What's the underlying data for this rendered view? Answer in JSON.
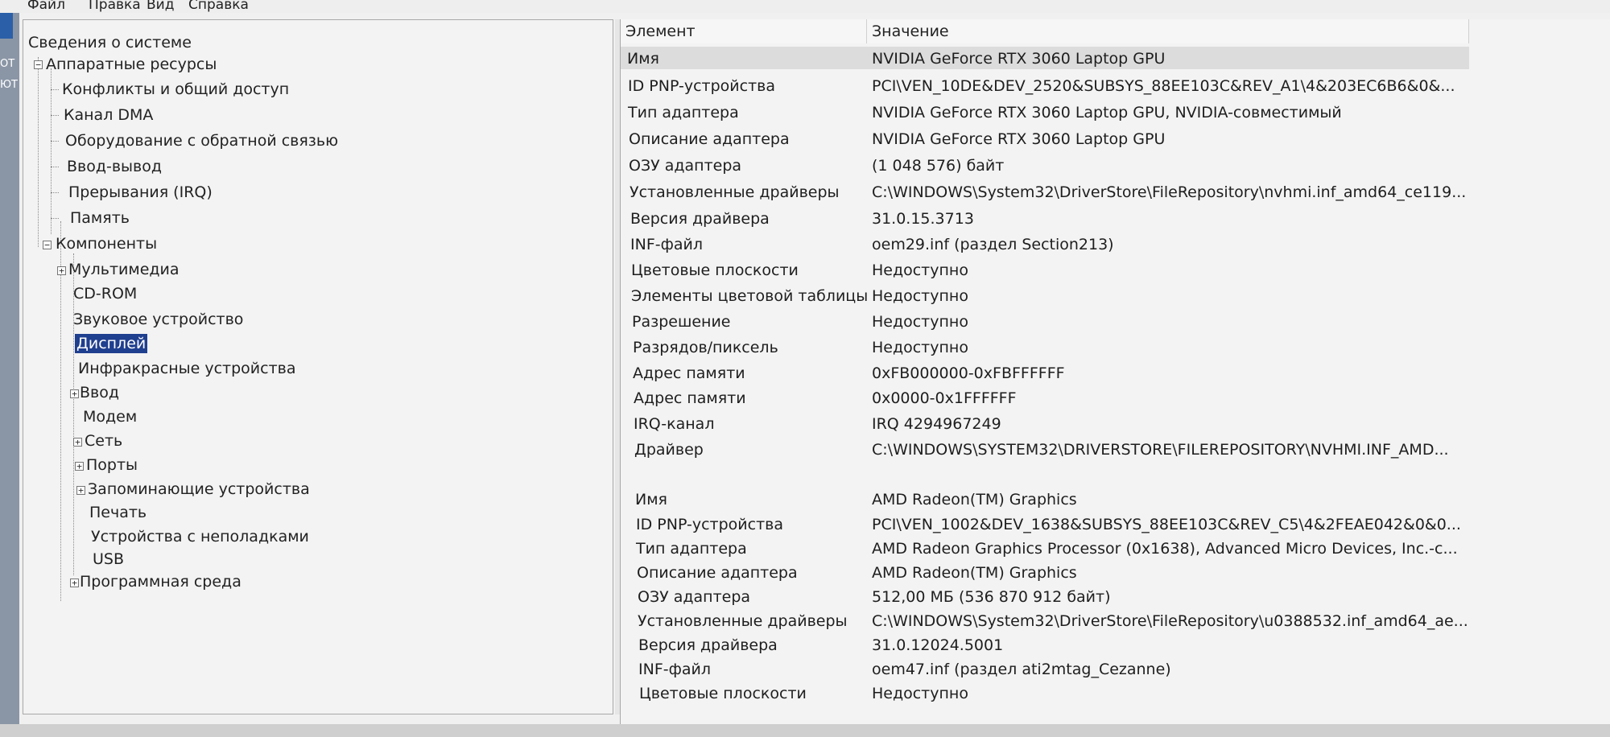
{
  "menu": {
    "file": "Файл",
    "edit": "Правка",
    "view": "Вид",
    "help": "Справка"
  },
  "background_fragments": [
    "ОТ",
    "ЮТ"
  ],
  "tree": {
    "root": "Сведения о системе",
    "hardware": {
      "label": "Аппаратные ресурсы",
      "items": [
        "Конфликты и общий доступ",
        "Канал DMA",
        "Оборудование с обратной связью",
        "Ввод-вывод",
        "Прерывания (IRQ)",
        "Память"
      ]
    },
    "components": {
      "label": "Компоненты",
      "items": [
        "Мультимедиа",
        "CD-ROM",
        "Звуковое устройство",
        "Дисплей",
        "Инфракрасные устройства",
        "Ввод",
        "Модем",
        "Сеть",
        "Порты",
        "Запоминающие устройства",
        "Печать",
        "Устройства с неполадками",
        "USB"
      ]
    },
    "software": "Программная среда",
    "selected": "Дисплей"
  },
  "list": {
    "columns": [
      "Элемент",
      "Значение"
    ],
    "rows": [
      [
        "Имя",
        "NVIDIA GeForce RTX 3060 Laptop GPU"
      ],
      [
        "ID PNP-устройства",
        "PCI\\VEN_10DE&DEV_2520&SUBSYS_88EE103C&REV_A1\\4&203EC6B6&0&..."
      ],
      [
        "Тип адаптера",
        "NVIDIA GeForce RTX 3060 Laptop GPU, NVIDIA-совместимый"
      ],
      [
        "Описание адаптера",
        "NVIDIA GeForce RTX 3060 Laptop GPU"
      ],
      [
        "ОЗУ адаптера",
        "(1 048 576) байт"
      ],
      [
        "Установленные драйверы",
        "C:\\WINDOWS\\System32\\DriverStore\\FileRepository\\nvhmi.inf_amd64_ce119..."
      ],
      [
        "Версия драйвера",
        "31.0.15.3713"
      ],
      [
        "INF-файл",
        "oem29.inf (раздел Section213)"
      ],
      [
        "Цветовые плоскости",
        "Недоступно"
      ],
      [
        "Элементы цветовой таблицы",
        "Недоступно"
      ],
      [
        "Разрешение",
        "Недоступно"
      ],
      [
        "Разрядов/пиксель",
        "Недоступно"
      ],
      [
        "Адрес памяти",
        "0xFB000000-0xFBFFFFFF"
      ],
      [
        "Адрес памяти",
        "0x0000-0x1FFFFFF"
      ],
      [
        "IRQ-канал",
        "IRQ 4294967249"
      ],
      [
        "Драйвер",
        "C:\\WINDOWS\\SYSTEM32\\DRIVERSTORE\\FILEREPOSITORY\\NVHMI.INF_AMD..."
      ],
      [
        "",
        ""
      ],
      [
        "Имя",
        "AMD Radeon(TM) Graphics"
      ],
      [
        "ID PNP-устройства",
        "PCI\\VEN_1002&DEV_1638&SUBSYS_88EE103C&REV_C5\\4&2FEAE042&0&0..."
      ],
      [
        "Тип адаптера",
        "AMD Radeon Graphics Processor (0x1638), Advanced Micro Devices, Inc.-c..."
      ],
      [
        "Описание адаптера",
        "AMD Radeon(TM) Graphics"
      ],
      [
        "ОЗУ адаптера",
        "512,00 МБ (536 870 912 байт)"
      ],
      [
        "Установленные драйверы",
        "C:\\WINDOWS\\System32\\DriverStore\\FileRepository\\u0388532.inf_amd64_ae..."
      ],
      [
        "Версия драйвера",
        "31.0.12024.5001"
      ],
      [
        "INF-файл",
        "oem47.inf (раздел ati2mtag_Cezanne)"
      ],
      [
        "Цветовые плоскости",
        "Недоступно"
      ]
    ]
  }
}
